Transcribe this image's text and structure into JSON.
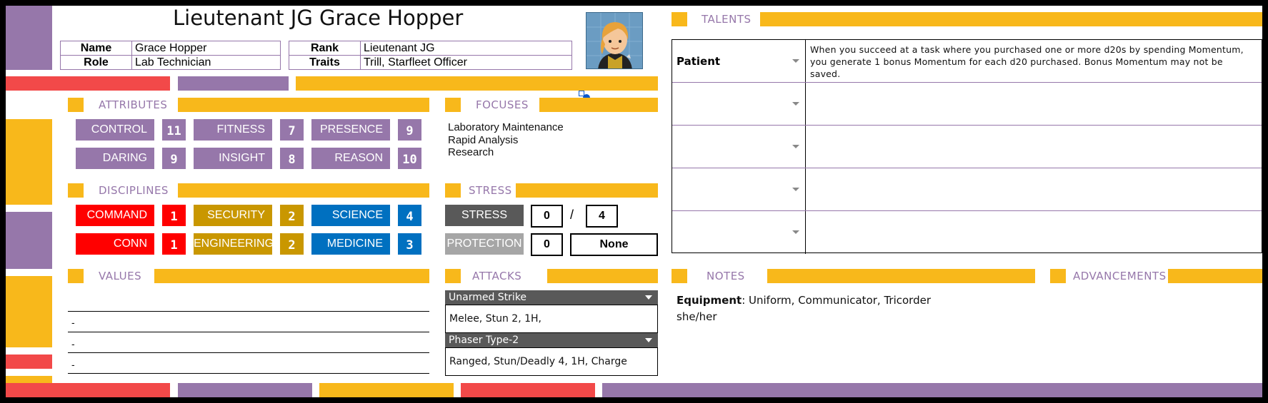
{
  "header": {
    "title": "Lieutenant JG Grace Hopper",
    "name_label": "Name",
    "name_value": "Grace Hopper",
    "role_label": "Role",
    "role_value": "Lab Technician",
    "rank_label": "Rank",
    "rank_value": "Lieutenant JG",
    "traits_label": "Traits",
    "traits_value": "Trill, Starfleet Officer"
  },
  "sections": {
    "talents": "TALENTS",
    "attributes": "ATTRIBUTES",
    "focuses": "FOCUSES",
    "disciplines": "DISCIPLINES",
    "stress": "STRESS",
    "values": "VALUES",
    "attacks": "ATTACKS",
    "notes": "NOTES",
    "advancements": "ADVANCEMENTS"
  },
  "attributes": [
    {
      "label": "CONTROL",
      "value": "11"
    },
    {
      "label": "FITNESS",
      "value": "7"
    },
    {
      "label": "PRESENCE",
      "value": "9"
    },
    {
      "label": "DARING",
      "value": "9"
    },
    {
      "label": "INSIGHT",
      "value": "8"
    },
    {
      "label": "REASON",
      "value": "10"
    }
  ],
  "disciplines": [
    {
      "label": "COMMAND",
      "value": "1"
    },
    {
      "label": "SECURITY",
      "value": "2"
    },
    {
      "label": "SCIENCE",
      "value": "4"
    },
    {
      "label": "CONN",
      "value": "1"
    },
    {
      "label": "ENGINEERING",
      "value": "2"
    },
    {
      "label": "MEDICINE",
      "value": "3"
    }
  ],
  "focuses": [
    "Laboratory Maintenance",
    "Rapid Analysis",
    "Research"
  ],
  "stress": {
    "label": "STRESS",
    "current": "0",
    "separator": "/",
    "max": "4",
    "protection_label": "PROTECTION",
    "protection_value": "0",
    "protection_type": "None"
  },
  "values": [
    "",
    "-",
    "-",
    "-"
  ],
  "attacks": [
    {
      "name": "Unarmed Strike",
      "detail": "Melee, Stun 2, 1H,"
    },
    {
      "name": "Phaser Type-2",
      "detail": "Ranged, Stun/Deadly 4, 1H, Charge"
    }
  ],
  "talents": [
    {
      "name": "Patient",
      "desc": "When you succeed at a task where you purchased one or more d20s by spending Momentum, you generate 1 bonus Momentum for each d20 purchased. Bonus Momentum may not be saved."
    },
    {
      "name": "",
      "desc": ""
    },
    {
      "name": "",
      "desc": ""
    },
    {
      "name": "",
      "desc": ""
    },
    {
      "name": "",
      "desc": ""
    }
  ],
  "notes": {
    "equipment_label": "Equipment",
    "equipment_value": ": Uniform, Communicator, Tricorder",
    "pronouns": "she/her"
  },
  "colors": {
    "lcars_yellow": "#f8b81b",
    "lcars_purple": "#9677aa",
    "lcars_red": "#f24949",
    "command_red": "#ff0000",
    "ops_gold": "#c99700",
    "sci_blue": "#0070c0"
  }
}
